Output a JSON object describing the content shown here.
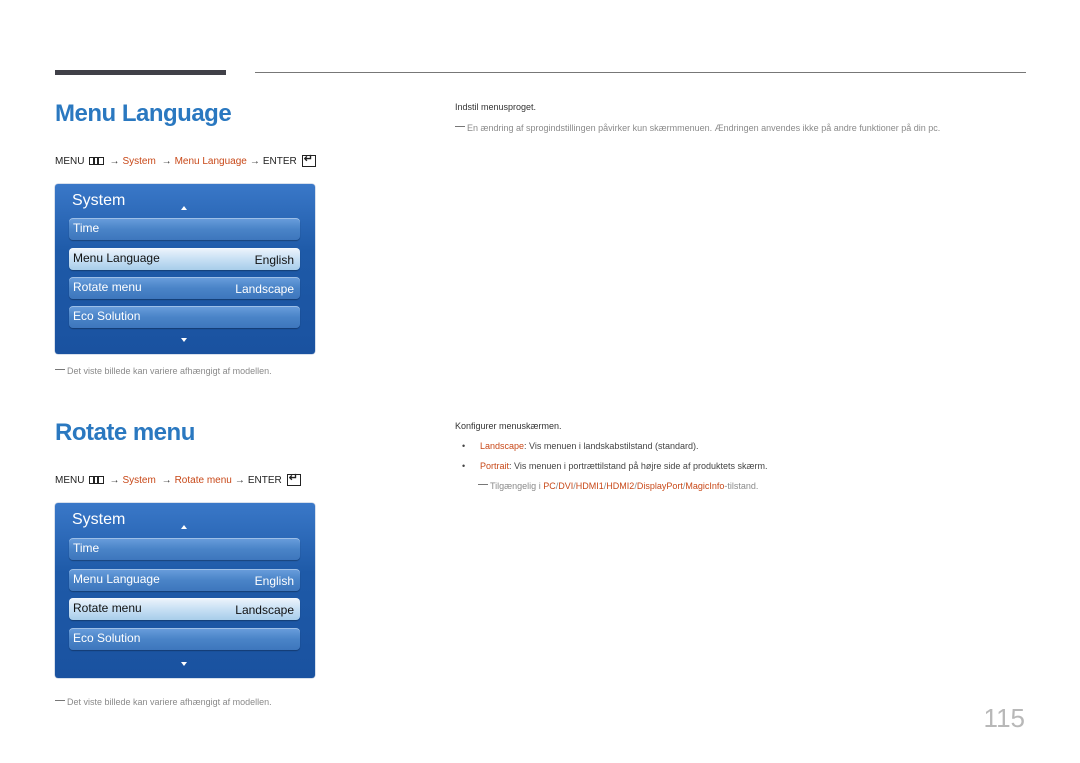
{
  "section1": {
    "title": "Menu Language",
    "breadcrumb": {
      "menu": "MENU",
      "menu_icon": "menu-grid-icon",
      "system": "System",
      "item": "Menu Language",
      "enter": "ENTER",
      "enter_icon": "enter-icon"
    },
    "osd": {
      "title": "System",
      "items": [
        {
          "label": "Time",
          "value": ""
        },
        {
          "label": "Menu Language",
          "value": "English",
          "selected": true
        },
        {
          "label": "Rotate menu",
          "value": "Landscape"
        },
        {
          "label": "Eco Solution",
          "value": ""
        }
      ]
    },
    "image_note": "Det viste billede kan variere afhængigt af modellen.",
    "description": "Indstil menusproget.",
    "description_note": "En ændring af sprogindstillingen påvirker kun skærmmenuen. Ændringen anvendes ikke på andre funktioner på din pc."
  },
  "section2": {
    "title": "Rotate menu",
    "breadcrumb": {
      "menu": "MENU",
      "menu_icon": "menu-grid-icon",
      "system": "System",
      "item": "Rotate menu",
      "enter": "ENTER",
      "enter_icon": "enter-icon"
    },
    "osd": {
      "title": "System",
      "items": [
        {
          "label": "Time",
          "value": ""
        },
        {
          "label": "Menu Language",
          "value": "English"
        },
        {
          "label": "Rotate menu",
          "value": "Landscape",
          "selected": true
        },
        {
          "label": "Eco Solution",
          "value": ""
        }
      ]
    },
    "image_note": "Det viste billede kan variere afhængigt af modellen.",
    "description": "Konfigurer menuskærmen.",
    "options": [
      {
        "name": "Landscape",
        "text": ": Vis menuen i landskabstilstand (standard)."
      },
      {
        "name": "Portrait",
        "text": ": Vis menuen i portrættilstand på højre side af produktets skærm."
      }
    ],
    "availability_note": {
      "prefix": "Tilgængelig i ",
      "sources": [
        "PC",
        "DVI",
        "HDMI1",
        "HDMI2",
        "DisplayPort",
        "MagicInfo"
      ],
      "separator": "/",
      "suffix": "-tilstand."
    }
  },
  "page_number": "115",
  "colors": {
    "heading": "#2a78c0",
    "accent_red": "#c84818",
    "osd_blue": "#1e5aa8"
  }
}
